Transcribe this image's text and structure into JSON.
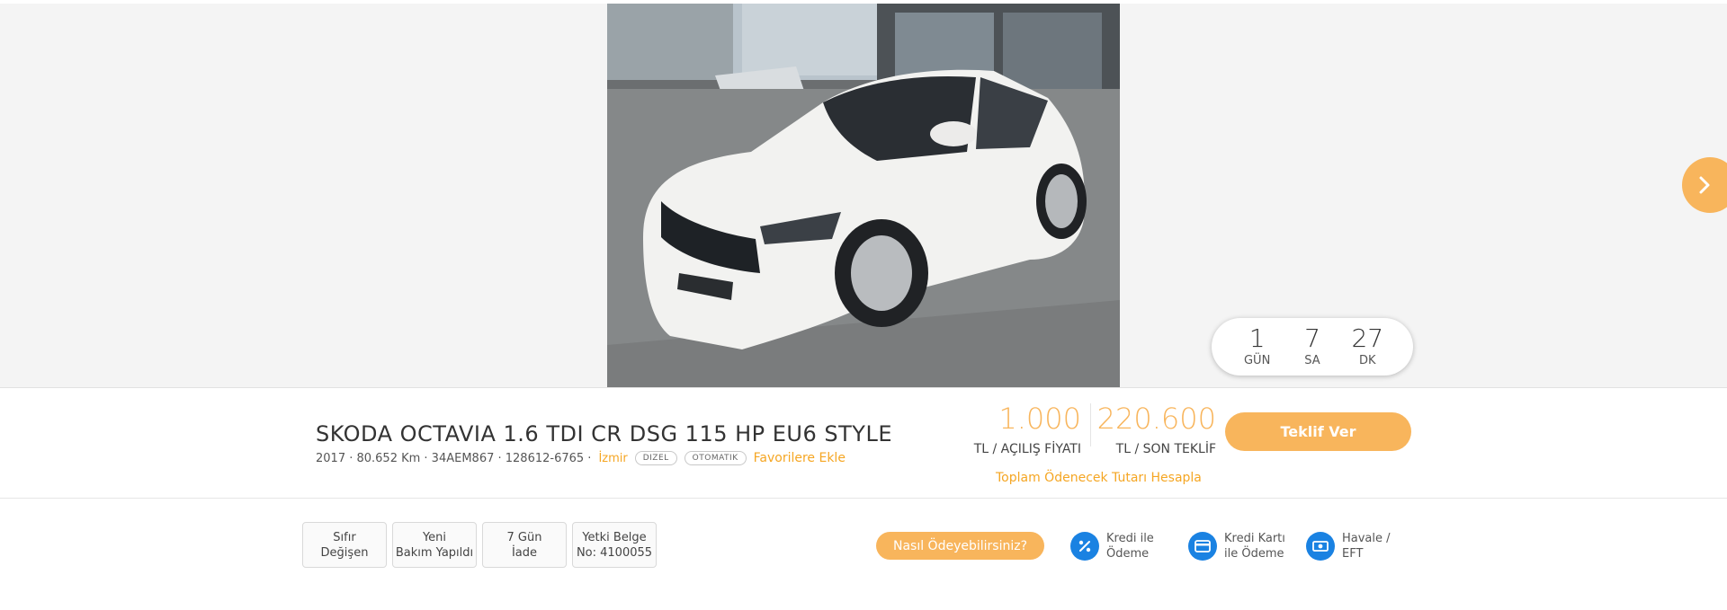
{
  "countdown": {
    "days": "1",
    "days_label": "GÜN",
    "hours": "7",
    "hours_label": "SA",
    "minutes": "27",
    "minutes_label": "DK"
  },
  "listing": {
    "title": "SKODA OCTAVIA 1.6 TDI CR DSG 115 HP EU6 STYLE",
    "meta": "2017 · 80.652 Km · 34AEM867 · 128612-6765 ·",
    "city": "İzmir",
    "tags": [
      "DIZEL",
      "OTOMATIK"
    ],
    "favorite_label": "Favorilere Ekle"
  },
  "pricing": {
    "opening_price": "1.000",
    "opening_label": "TL / AÇILIŞ FİYATI",
    "last_bid": "220.600",
    "last_bid_label": "TL / SON TEKLİF",
    "bid_button": "Teklif Ver",
    "calc_link": "Toplam Ödenecek Tutarı Hesapla"
  },
  "features": [
    {
      "line1": "Sıfır",
      "line2": "Değişen"
    },
    {
      "line1": "Yeni",
      "line2": "Bakım Yapıldı"
    },
    {
      "line1": "7 Gün",
      "line2": "İade"
    },
    {
      "line1": "Yetki Belge",
      "line2": "No: 4100055"
    }
  ],
  "payment": {
    "button": "Nasıl Ödeyebilirsiniz?",
    "options": [
      {
        "label": "Kredi ile\nÖdeme",
        "icon": "percent-icon"
      },
      {
        "label": "Kredi Kartı\nile Ödeme",
        "icon": "credit-card-icon"
      },
      {
        "label": "Havale /\nEFT",
        "icon": "cash-icon"
      }
    ]
  },
  "colors": {
    "accent": "#f8b55c",
    "link": "#f5a623",
    "payment_icon": "#1a82e2"
  }
}
